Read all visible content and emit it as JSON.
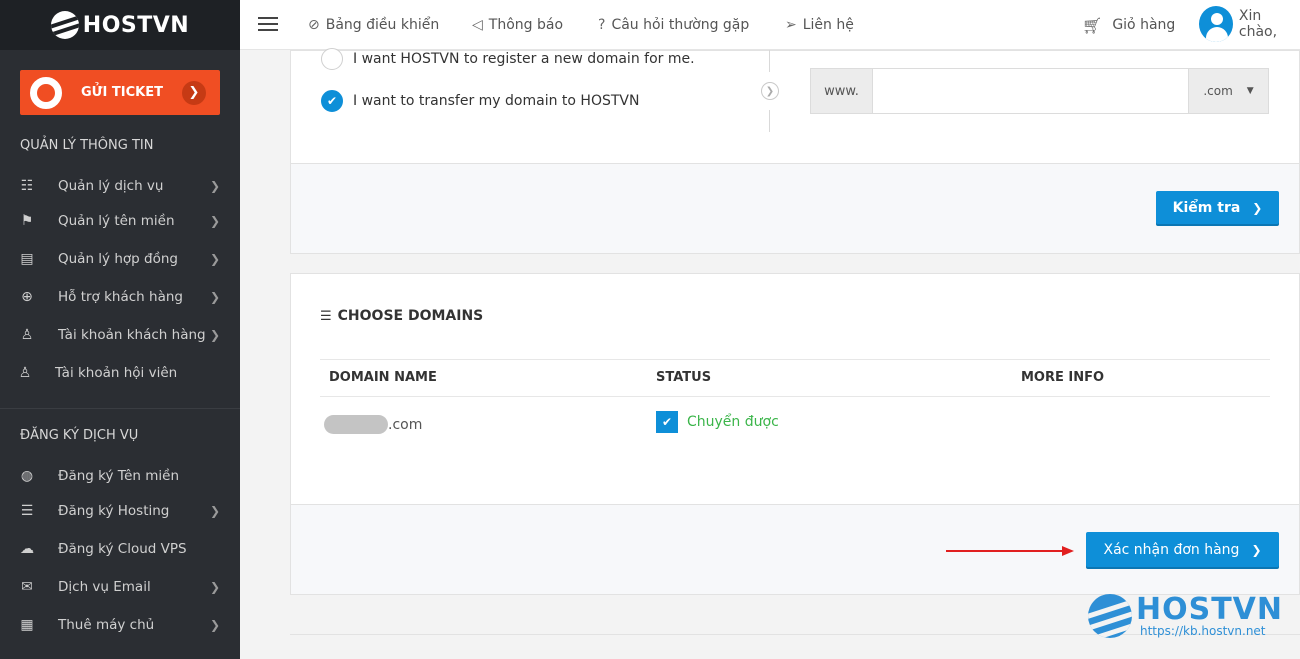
{
  "brand": {
    "name": "HOSTVN"
  },
  "sidebar": {
    "ticket_button": "GỬI TICKET",
    "section_info": "QUẢN LÝ THÔNG TIN",
    "info_items": [
      {
        "label": "Quản lý dịch vụ",
        "icon": "sliders-icon"
      },
      {
        "label": "Quản lý tên miền",
        "icon": "signpost-icon"
      },
      {
        "label": "Quản lý hợp đồng",
        "icon": "contract-icon"
      },
      {
        "label": "Hỗ trợ khách hàng",
        "icon": "lifebuoy-icon"
      },
      {
        "label": "Tài khoản khách hàng",
        "icon": "user-icon"
      },
      {
        "label": "Tài khoản hội viên",
        "icon": "member-icon"
      }
    ],
    "section_services": "ĐĂNG KÝ DỊCH VỤ",
    "service_items": [
      {
        "label": "Đăng ký Tên miền",
        "icon": "globe-icon"
      },
      {
        "label": "Đăng ký Hosting",
        "icon": "server-list-icon"
      },
      {
        "label": "Đăng ký Cloud VPS",
        "icon": "cloud-icon"
      },
      {
        "label": "Dịch vụ Email",
        "icon": "envelope-icon"
      },
      {
        "label": "Thuê máy chủ",
        "icon": "server-icon"
      }
    ]
  },
  "topbar": {
    "dashboard": "Bảng điều khiển",
    "notifications": "Thông báo",
    "faq": "Câu hỏi thường gặp",
    "contact": "Liên hệ",
    "cart": "Giỏ hàng",
    "greeting": "Xin chào,"
  },
  "domain_form": {
    "option_register": "I want HOSTVN to register a new domain for me.",
    "option_transfer": "I want to transfer my domain to HOSTVN",
    "selected_option": "transfer",
    "prefix": "www.",
    "input_value": "",
    "tld": ".com",
    "check_button": "Kiểm tra"
  },
  "choose_domains": {
    "title": "CHOOSE DOMAINS",
    "columns": [
      "DOMAIN NAME",
      "STATUS",
      "MORE INFO"
    ],
    "rows": [
      {
        "domain_suffix": ".com",
        "status": "Chuyển được",
        "more_info": ""
      }
    ],
    "confirm_button": "Xác nhận đơn hàng"
  },
  "watermark": {
    "brand": "HOSTVN",
    "url": "https://kb.hostvn.net"
  },
  "colors": {
    "accent": "#0e8fd8",
    "ticket": "#f04e23",
    "sidebar": "#2b2e33",
    "status_ok": "#3bb54a",
    "annotation": "#e11f1f"
  }
}
